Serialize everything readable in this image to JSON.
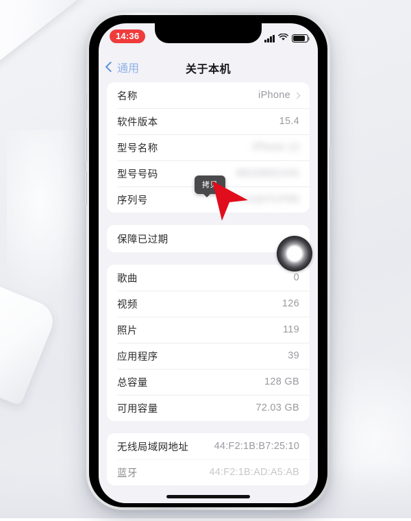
{
  "status_bar": {
    "time": "14:36",
    "recording_indicator": true,
    "signal_icon": "cellular-signal-icon",
    "wifi_icon": "wifi-icon",
    "battery_icon": "battery-icon"
  },
  "nav": {
    "back_label": "通用",
    "title": "关于本机"
  },
  "overlay": {
    "tooltip_label": "拷贝",
    "cursor": "red-arrow-cursor",
    "touch_indicator": "touch-ring-indicator"
  },
  "sections": [
    {
      "name": "device-info",
      "rows": [
        {
          "label": "名称",
          "value": "iPhone",
          "chevron": true,
          "blurred": false
        },
        {
          "label": "软件版本",
          "value": "15.4",
          "chevron": false,
          "blurred": false
        },
        {
          "label": "型号名称",
          "value": "iPhone 12",
          "chevron": false,
          "blurred": true
        },
        {
          "label": "型号号码",
          "value": "MGGM3CH/A",
          "chevron": false,
          "blurred": true
        },
        {
          "label": "序列号",
          "value": "FK1QX7LP0D",
          "chevron": false,
          "blurred": true
        }
      ]
    },
    {
      "name": "coverage",
      "rows": [
        {
          "label": "保障已过期",
          "value": "",
          "chevron": false,
          "blurred": false
        }
      ]
    },
    {
      "name": "media-counts",
      "rows": [
        {
          "label": "歌曲",
          "value": "0",
          "chevron": false,
          "blurred": false
        },
        {
          "label": "视频",
          "value": "126",
          "chevron": false,
          "blurred": false
        },
        {
          "label": "照片",
          "value": "119",
          "chevron": false,
          "blurred": false
        },
        {
          "label": "应用程序",
          "value": "39",
          "chevron": false,
          "blurred": false
        },
        {
          "label": "总容量",
          "value": "128 GB",
          "chevron": false,
          "blurred": false
        },
        {
          "label": "可用容量",
          "value": "72.03 GB",
          "chevron": false,
          "blurred": false
        }
      ]
    },
    {
      "name": "network-addresses",
      "rows": [
        {
          "label": "无线局域网地址",
          "value": "44:F2:1B:B7:25:10",
          "chevron": false,
          "blurred": false
        },
        {
          "label": "蓝牙",
          "value": "44:F2:1B:AD:A5:AB",
          "chevron": false,
          "blurred": false
        }
      ]
    }
  ],
  "colors": {
    "accent_blue": "#5c8fd6",
    "recording_red": "#f03b3b",
    "cursor_red": "#e00d1c",
    "screen_bg": "#f2f2f7",
    "card_bg": "#ffffff"
  }
}
